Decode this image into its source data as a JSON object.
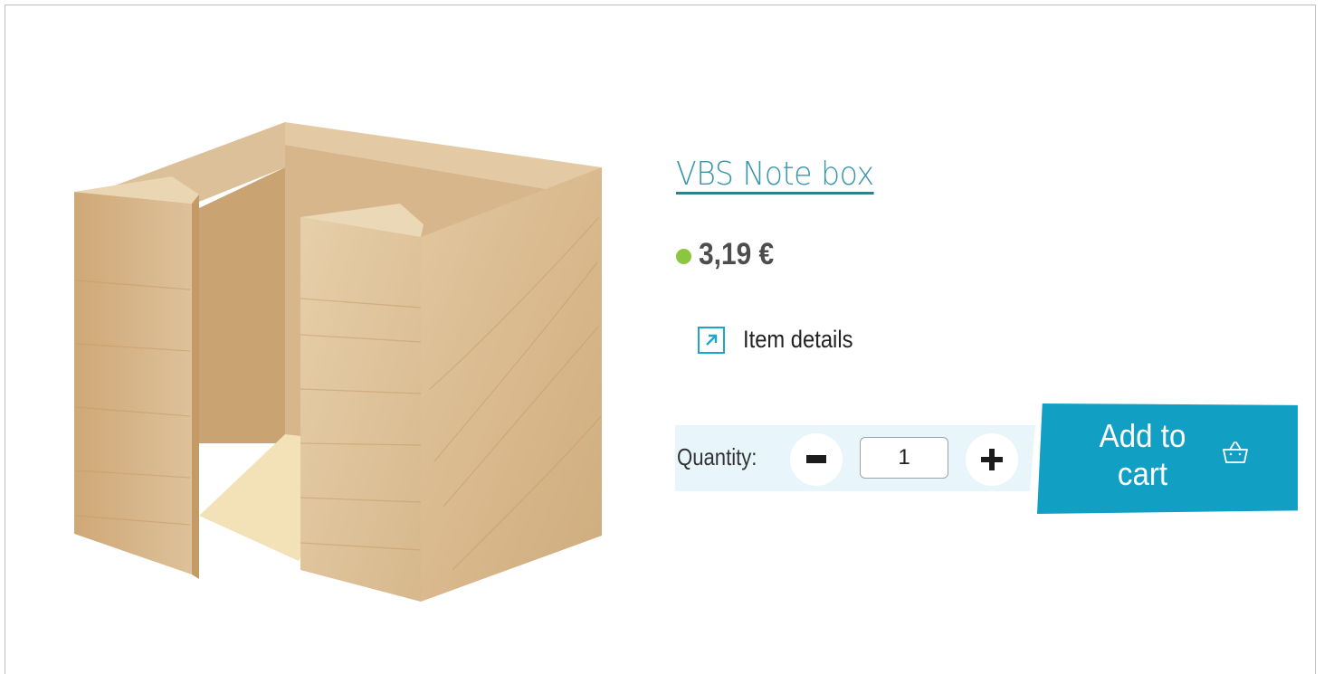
{
  "product": {
    "title": "VBS Note box",
    "price": "3,19 €",
    "stock_status_color": "#8cc63f",
    "image_alt": "wooden note box"
  },
  "details_link": {
    "label": "Item details",
    "icon": "external-arrow-icon"
  },
  "quantity": {
    "label": "Quantity:",
    "value": "1",
    "decrement_icon": "minus-icon",
    "increment_icon": "plus-icon"
  },
  "cart": {
    "label": "Add to cart",
    "icon": "basket-icon"
  },
  "colors": {
    "accent": "#129fc4",
    "title": "#3a97ab",
    "panel": "#e8f6fb"
  }
}
